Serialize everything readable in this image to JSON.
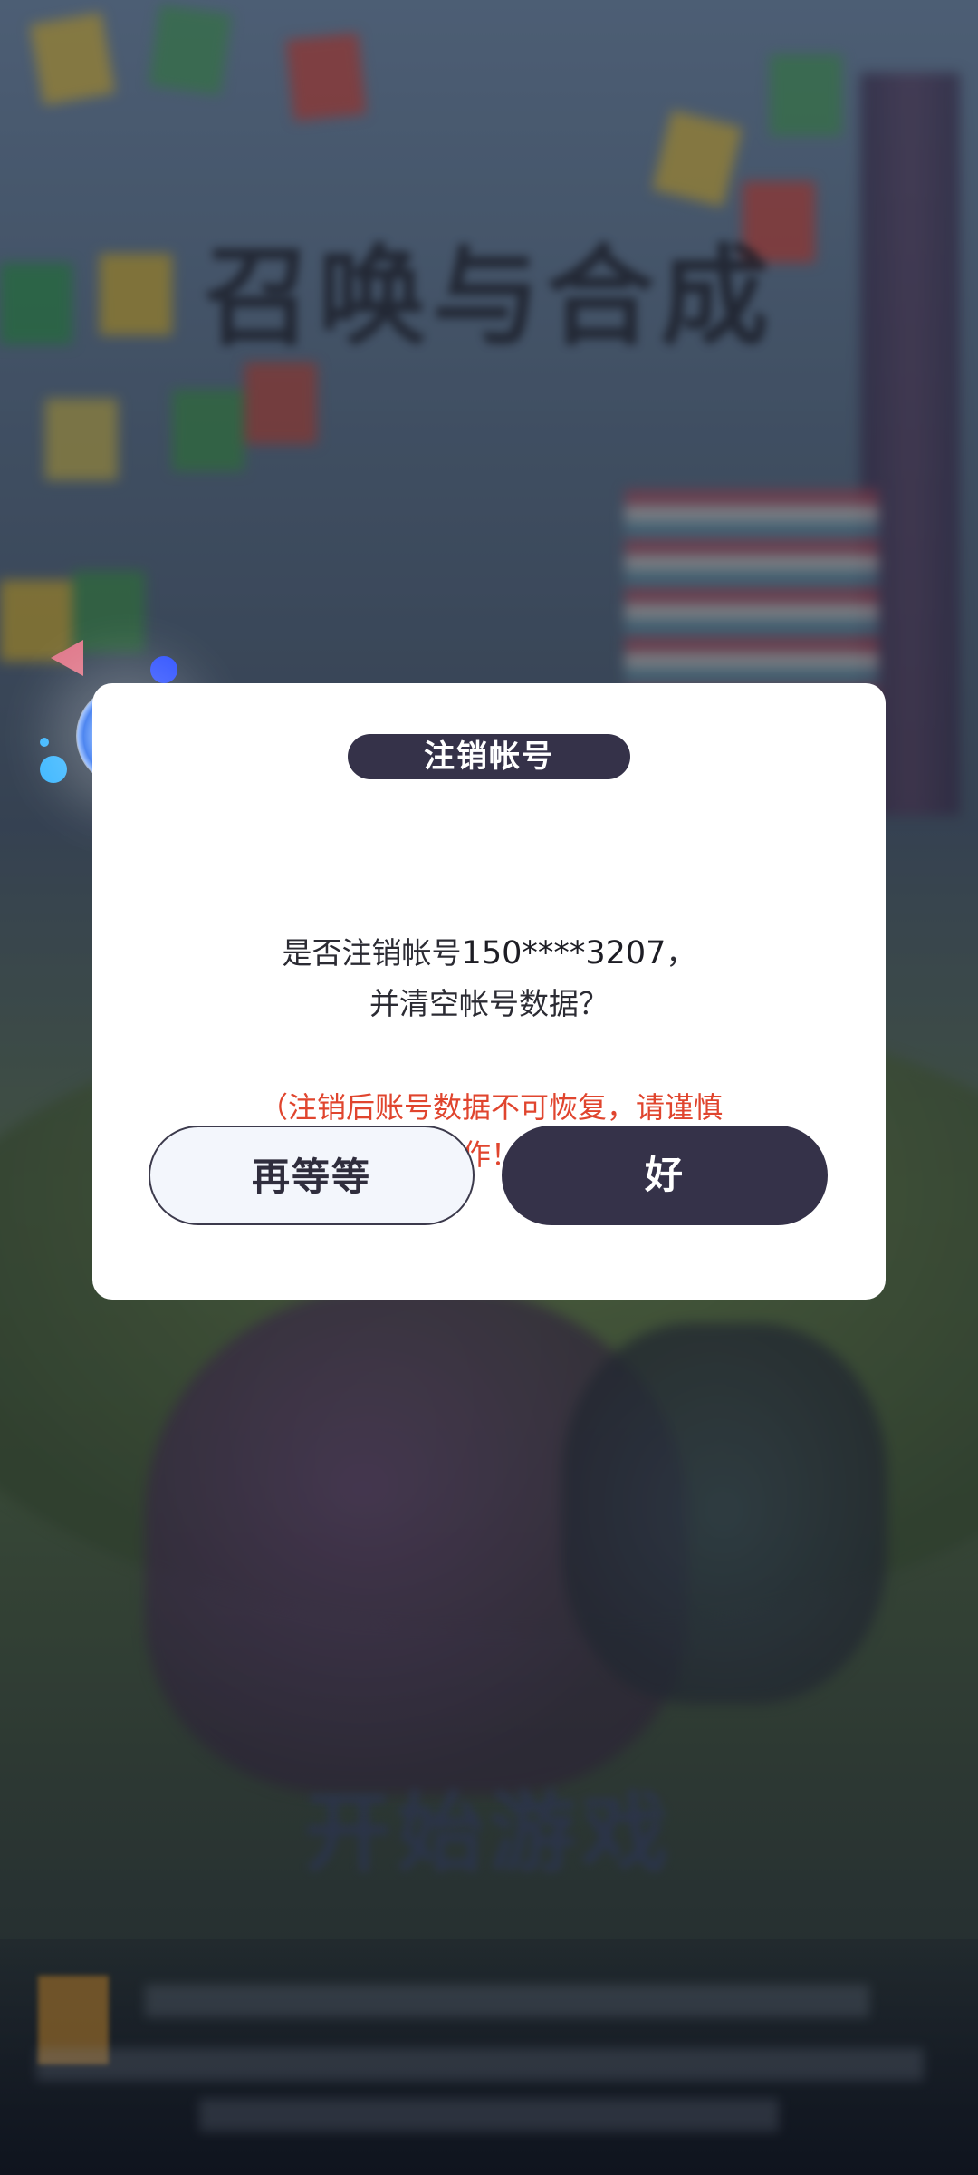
{
  "background": {
    "game_title": "召唤与合成",
    "start_button_label": "开始游戏"
  },
  "dialog": {
    "title": "注销帐号",
    "message_prefix": "是否注销帐号",
    "phone_masked": "150****3207",
    "message_suffix": "，",
    "message_line2": "并清空帐号数据？",
    "warning_line1": "（注销后账号数据不可恢复，请谨慎",
    "warning_line2": "操作！）",
    "cancel_label": "再等等",
    "confirm_label": "好"
  },
  "colors": {
    "accent_dark": "#353249",
    "warning_red": "#e0452e",
    "cancel_bg": "#f3f6fc"
  }
}
